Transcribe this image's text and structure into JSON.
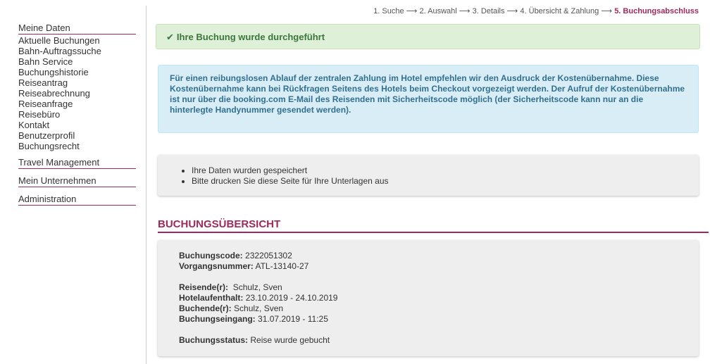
{
  "sidebar": {
    "groups": [
      {
        "title": "Meine Daten",
        "items": [
          "Aktuelle Buchungen",
          "Bahn-Auftragssuche",
          "Bahn Service",
          "Buchungshistorie",
          "Reiseantrag",
          "Reiseabrechnung",
          "Reiseanfrage",
          "Reisebüro",
          "Kontakt",
          "Benutzerprofil",
          "Buchungsrecht"
        ]
      },
      {
        "title": "Travel Management"
      },
      {
        "title": "Mein Unternehmen"
      },
      {
        "title": "Administration"
      }
    ]
  },
  "steps": {
    "items": [
      "1. Suche",
      "2. Auswahl",
      "3. Details",
      "4. Übersicht & Zahlung"
    ],
    "active": "5. Buchungsabschluss",
    "separator": "⟶"
  },
  "success_message": "Ihre Buchung wurde durchgeführt",
  "info_message": "Für einen reibungslosen Ablauf der zentralen Zahlung im Hotel empfehlen wir den Ausdruck der Kostenübernahme. Diese Kostenübernahme kann bei Rückfragen Seitens des Hotels beim Checkout vorgezeigt werden. Der Aufruf der Kostenübernahme ist nur über die booking.com E-Mail des Reisenden mit Sicherheitscode möglich (der Sicherheitscode kann nur an die hinterlegte Handynummer gesendet werden).",
  "notes": [
    "Ihre Daten wurden gespeichert",
    "Bitte drucken Sie diese Seite für Ihre Unterlagen aus"
  ],
  "summary": {
    "title": "BUCHUNGSÜBERSICHT",
    "buchungscode_label": "Buchungscode:",
    "buchungscode": "2322051302",
    "vorgangsnummer_label": "Vorgangsnummer:",
    "vorgangsnummer": "ATL-13140-27",
    "reisende_label": "Reisende(r):",
    "reisende": "Schulz, Sven",
    "hotelaufenthalt_label": "Hotelaufenthalt:",
    "hotelaufenthalt": "23.10.2019 - 24.10.2019",
    "buchende_label": "Buchende(r):",
    "buchende": "Schulz, Sven",
    "buchungseingang_label": "Buchungseingang:",
    "buchungseingang": "31.07.2019 - 11:25",
    "status_label": "Buchungsstatus:",
    "status": "Reise wurde gebucht"
  },
  "colors": {
    "accent": "#a0285a",
    "success_bg": "#dff0d8",
    "success_text": "#3c763d",
    "info_bg": "#d9edf7",
    "info_text": "#31708f"
  },
  "icons": {
    "success": "check-icon"
  }
}
